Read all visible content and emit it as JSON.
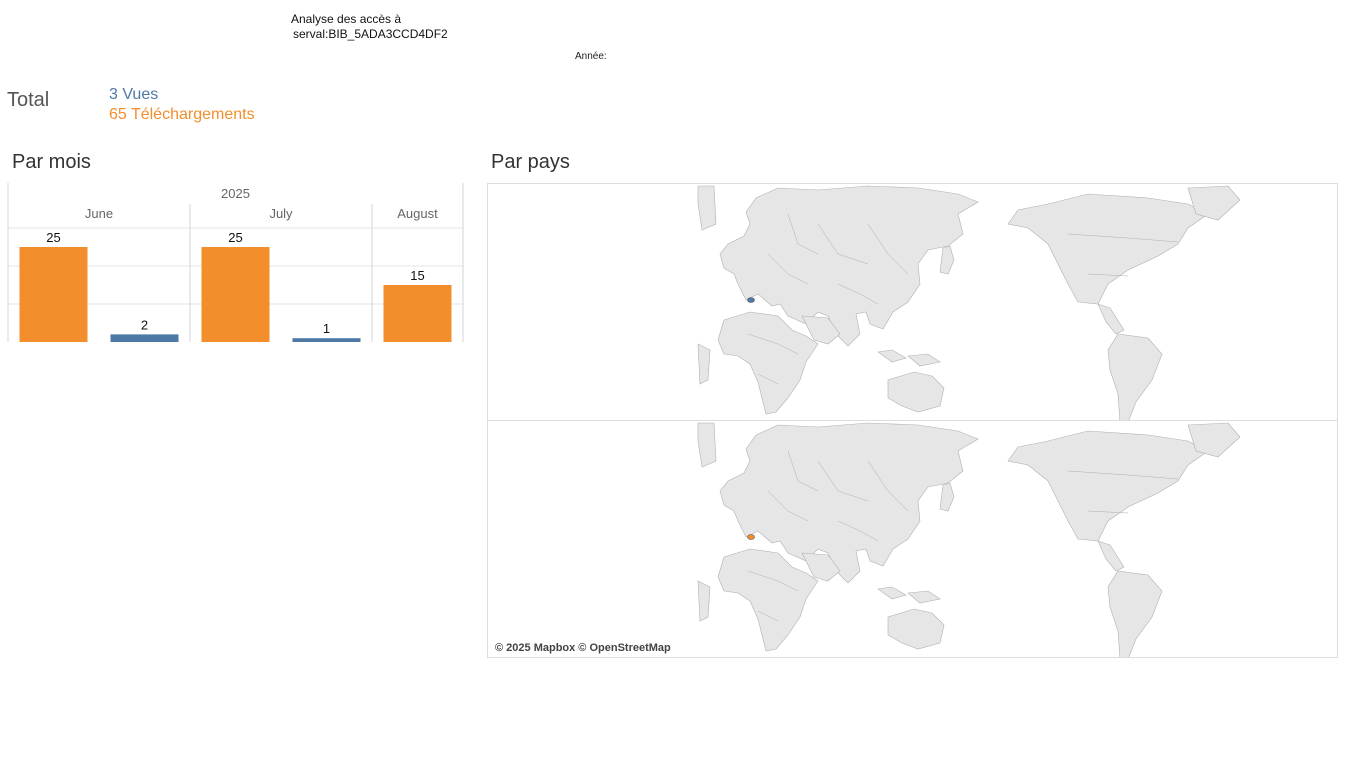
{
  "header": {
    "title_line1": "Analyse des accès à",
    "title_line2": "serval:BIB_5ADA3CCD4DF2",
    "year_filter_label": "Année:"
  },
  "totals": {
    "label": "Total",
    "views": "3 Vues",
    "downloads": "65 Téléchargements"
  },
  "sections": {
    "monthly_title": "Par mois",
    "country_title": "Par pays"
  },
  "colors": {
    "views": "#4e79a7",
    "downloads": "#f28e2b",
    "grid": "#e6e6e6",
    "land": "#e6e6e6",
    "country_border": "#b0b0b0"
  },
  "chart_data": {
    "type": "bar",
    "year": "2025",
    "categories": [
      "June",
      "July",
      "August"
    ],
    "series": [
      {
        "color_key": "downloads",
        "values": [
          25,
          25,
          15
        ]
      },
      {
        "color_key": "views",
        "values": [
          2,
          1,
          null
        ]
      }
    ],
    "ylim": [
      0,
      30
    ],
    "grid": true,
    "legend": "none"
  },
  "map": {
    "attribution": "© 2025 Mapbox © OpenStreetMap",
    "highlight_country": "Switzerland",
    "top_panel_color_key": "views",
    "bottom_panel_color_key": "downloads"
  }
}
